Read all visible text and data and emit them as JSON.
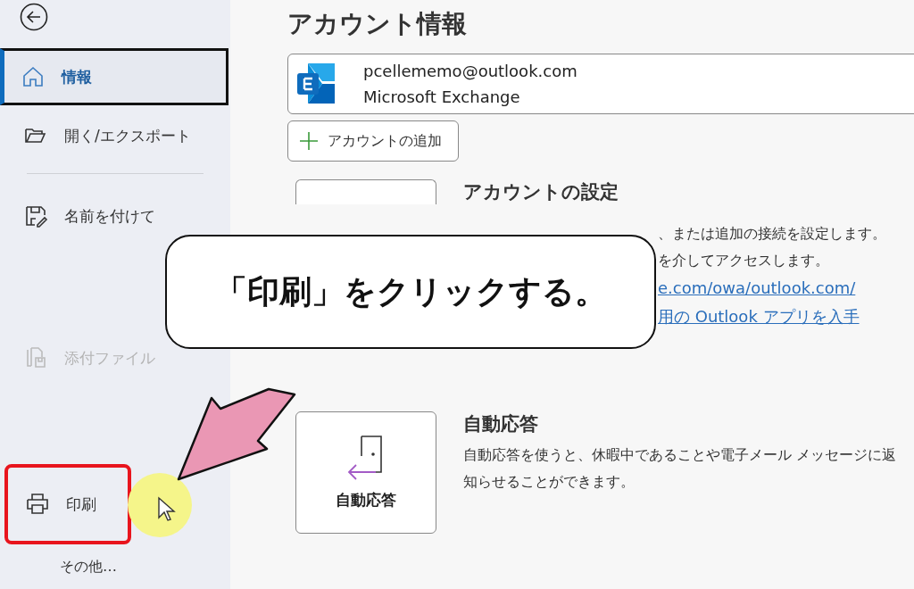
{
  "sidebar": {
    "items": [
      {
        "kind": "nav",
        "label": "情報",
        "selected": true,
        "disabled": false,
        "highlighted": false
      },
      {
        "kind": "nav",
        "label": "開く/エクスポート",
        "selected": false,
        "disabled": false,
        "highlighted": false
      },
      {
        "kind": "divider"
      },
      {
        "kind": "nav",
        "label": "名前を付けて",
        "selected": false,
        "disabled": false,
        "highlighted": false
      },
      {
        "kind": "nav",
        "label": "添付ファイル",
        "selected": false,
        "disabled": true,
        "highlighted": false
      },
      {
        "kind": "nav",
        "label": "印刷",
        "selected": false,
        "disabled": false,
        "highlighted": true
      },
      {
        "kind": "more",
        "label": "その他…"
      }
    ]
  },
  "main": {
    "title": "アカウント情報",
    "account": {
      "email": "pcellememo@outlook.com",
      "type": "Microsoft Exchange"
    },
    "add_button": "アカウントの追加",
    "sections": [
      {
        "kind": "settings",
        "title": "アカウントの設定",
        "lines": [
          "、または追加の接続を設定します。",
          "を介してアクセスします。"
        ],
        "links": [
          "e.com/owa/outlook.com/",
          "用の Outlook アプリを入手"
        ]
      },
      {
        "kind": "autoreply",
        "tile": "自動応答",
        "title": "自動応答",
        "lines": [
          "自動応答を使うと、休暇中であることや電子メール メッセージに返",
          "知らせることができます。"
        ]
      }
    ]
  },
  "overlay": {
    "callout": "「印刷」をクリックする。"
  }
}
